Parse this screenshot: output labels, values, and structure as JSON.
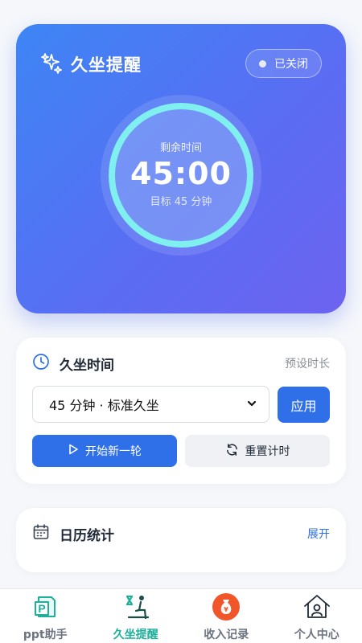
{
  "hero": {
    "title": "久坐提醒",
    "status": "已关闭",
    "remaining_label": "剩余时间",
    "time": "45:00",
    "target": "目标 45 分钟"
  },
  "settings": {
    "title": "久坐时间",
    "hint": "预设时长",
    "select_value": "45 分钟 · 标准久坐",
    "apply_label": "应用",
    "start_label": "开始新一轮",
    "reset_label": "重置计时"
  },
  "calendar": {
    "title": "日历统计",
    "expand_label": "展开"
  },
  "tabs": [
    {
      "label": "ppt助手",
      "icon": "ppt-icon"
    },
    {
      "label": "久坐提醒",
      "icon": "sitting-icon",
      "active": true
    },
    {
      "label": "收入记录",
      "icon": "money-bag-icon"
    },
    {
      "label": "个人中心",
      "icon": "home-user-icon"
    }
  ],
  "colors": {
    "accent": "#2f6fe8",
    "ring": "#7ff0ef",
    "active_tab": "#1faf9b",
    "money_icon": "#f0562a"
  }
}
